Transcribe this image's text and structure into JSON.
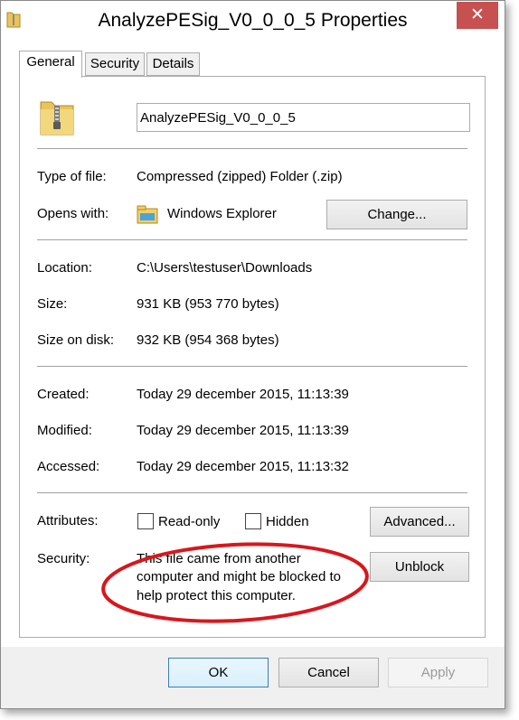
{
  "window": {
    "title": "AnalyzePESig_V0_0_0_5 Properties",
    "close_glyph": "✕"
  },
  "tabs": [
    {
      "label": "General"
    },
    {
      "label": "Security"
    },
    {
      "label": "Details"
    }
  ],
  "general": {
    "file_name": "AnalyzePESig_V0_0_0_5",
    "type_label": "Type of file:",
    "type_value": "Compressed (zipped) Folder (.zip)",
    "opens_label": "Opens with:",
    "opens_value": "Windows Explorer",
    "change_button": "Change...",
    "location_label": "Location:",
    "location_value": "C:\\Users\\testuser\\Downloads",
    "size_label": "Size:",
    "size_value": "931 KB (953 770 bytes)",
    "size_disk_label": "Size on disk:",
    "size_disk_value": "932 KB (954 368 bytes)",
    "created_label": "Created:",
    "created_value": "Today 29 december 2015, 11:13:39",
    "modified_label": "Modified:",
    "modified_value": "Today 29 december 2015, 11:13:39",
    "accessed_label": "Accessed:",
    "accessed_value": "Today 29 december 2015, 11:13:32",
    "attributes_label": "Attributes:",
    "readonly_label": "Read-only",
    "hidden_label": "Hidden",
    "advanced_button": "Advanced...",
    "security_label": "Security:",
    "security_line1": "This file came from another",
    "security_line2": "computer and might be blocked to",
    "security_line3": "help protect this computer.",
    "unblock_button": "Unblock"
  },
  "footer": {
    "ok": "OK",
    "cancel": "Cancel",
    "apply": "Apply"
  },
  "colors": {
    "close_button": "#c75050",
    "annotation": "#d9161c",
    "folder": "#e8c45a"
  }
}
